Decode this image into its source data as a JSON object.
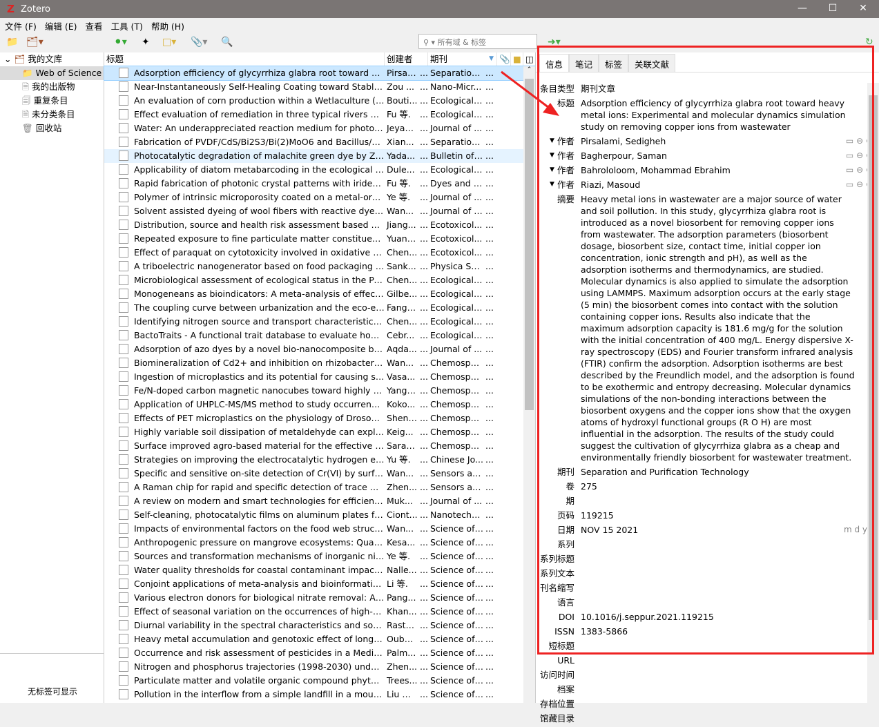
{
  "window": {
    "title": "Zotero",
    "icon": "zotero-logo-icon"
  },
  "menu": [
    "文件 (F)",
    "编辑 (E)",
    "查看",
    "工具 (T)",
    "帮助 (H)"
  ],
  "search": {
    "placeholder": "所有域 & 标签"
  },
  "collections": [
    {
      "label": "我的文库",
      "icon": "library-icon",
      "level": 0
    },
    {
      "label": "Web of Science",
      "icon": "folder-icon",
      "level": 1,
      "selected": true
    },
    {
      "label": "我的出版物",
      "icon": "publications-icon",
      "level": 1
    },
    {
      "label": "重复条目",
      "icon": "duplicate-icon",
      "level": 1
    },
    {
      "label": "未分类条目",
      "icon": "unfiled-icon",
      "level": 1
    },
    {
      "label": "回收站",
      "icon": "trash-icon",
      "level": 1
    }
  ],
  "tag_selector": {
    "empty_text": "无标签可显示"
  },
  "columns": {
    "title": "标题",
    "creator": "创建者",
    "journal": "期刊"
  },
  "items": [
    [
      "Adsorption efficiency of glycyrrhiza glabra root toward heavy metal ions",
      "Pirsal...",
      "Separation ..."
    ],
    [
      "Near-Instantaneously Self-Healing Coating toward Stable and...",
      "Zou ...",
      "Nano-Micr..."
    ],
    [
      "An evaluation of corn production within a Wetlaculture (TM) s...",
      "Bouti...",
      "Ecological ..."
    ],
    [
      "Effect evaluation of remediation in three typical rivers with Va...",
      "Fu 等.",
      "Ecological ..."
    ],
    [
      "Water: An underappreciated reaction medium for photodimer...",
      "Jeyap...",
      "Journal of ..."
    ],
    [
      "Fabrication of PVDF/CdS/Bi2S3/Bi(2)MoO6 and Bacillus/PVA ...",
      "Xian...",
      "Separation ..."
    ],
    [
      "Photocatalytic degradation of malachite green dye by ZnO an...",
      "Yada...",
      "Bulletin of ..."
    ],
    [
      "Applicability of diatom metabarcoding in the ecological statu...",
      "Dule...",
      "Ecological I..."
    ],
    [
      "Rapid fabrication of photonic crystal patterns with iridescent s...",
      "Fu 等.",
      "Dyes and P..."
    ],
    [
      "Polymer of intrinsic microporosity coated on a metal-organic ...",
      "Ye 等.",
      "Journal of ..."
    ],
    [
      "Solvent assisted dyeing of wool fibers with reactive dyes in a t...",
      "Wan...",
      "Journal of I..."
    ],
    [
      "Distribution, source and health risk assessment based on the ...",
      "Jiang...",
      "Ecotoxicol..."
    ],
    [
      "Repeated exposure to fine particulate matter constituents lea...",
      "Yuan ...",
      "Ecotoxicol..."
    ],
    [
      "Effect of paraquat on cytotoxicity involved in oxidative stress ...",
      "Chen...",
      "Ecotoxicol..."
    ],
    [
      "A triboelectric nanogenerator based on food packaging Alum...",
      "Sank...",
      "Physica Scr..."
    ],
    [
      "Microbiological assessment of ecological status in the Pearl Ri...",
      "Chen...",
      "Ecological I..."
    ],
    [
      "Monogeneans as bioindicators: A meta-analysis of effect size ...",
      "Gilbe...",
      "Ecological I..."
    ],
    [
      "The coupling curve between urbanization and the eco-enviro...",
      "Fang ...",
      "Ecological I..."
    ],
    [
      "Identifying nitrogen source and transport characteristics of th...",
      "Chen...",
      "Ecological I..."
    ],
    [
      "BactoTraits - A functional trait database to evaluate how natu...",
      "Cebr...",
      "Ecological I..."
    ],
    [
      "Adsorption of azo dyes by a novel bio-nanocomposite based ...",
      "Aqda...",
      "Journal of ..."
    ],
    [
      "Biomineralization of Cd2+ and inhibition on rhizobacterial Cd...",
      "Wan...",
      "Chemosph..."
    ],
    [
      "Ingestion of microplastics and its potential for causing structu...",
      "Vasa...",
      "Chemosph..."
    ],
    [
      "Fe/N-doped carbon magnetic nanocubes toward highly effici...",
      "Yang ...",
      "Chemosph..."
    ],
    [
      "Application of UHPLC-MS/MS method to study occurrence an...",
      "Koko...",
      "Chemosph..."
    ],
    [
      "Effects of PET microplastics on the physiology of Drosophila",
      "Shen ...",
      "Chemosph..."
    ],
    [
      "Highly variable soil dissipation of metaldehyde can explain its...",
      "Keig...",
      "Chemosph..."
    ],
    [
      "Surface improved agro-based material for the effective separ...",
      "Sarav...",
      "Chemosph..."
    ],
    [
      "Strategies on improving the electrocatalytic hydrogen evoluti...",
      "Yu 等.",
      "Chinese Jo..."
    ],
    [
      "Specific and sensitive on-site detection of Cr(VI) by surface-e...",
      "Wan...",
      "Sensors an..."
    ],
    [
      "A Raman chip for rapid and specific detection of trace mercur...",
      "Zhen...",
      "Sensors an..."
    ],
    [
      "A review on modern and smart technologies for efficient wast...",
      "Muk...",
      "Journal of ..."
    ],
    [
      "Self-cleaning, photocatalytic films on aluminum plates for mu...",
      "Ciont...",
      "Nanotechn..."
    ],
    [
      "Impacts of environmental factors on the food web structure, ...",
      "Wan...",
      "Science of ..."
    ],
    [
      "Anthropogenic pressure on mangrove ecosystems: Quantifica...",
      "Kesa...",
      "Science of ..."
    ],
    [
      "Sources and transformation mechanisms of inorganic nitroge...",
      "Ye 等.",
      "Science of ..."
    ],
    [
      "Water quality thresholds for coastal contaminant impacts on ...",
      "Nalle...",
      "Science of ..."
    ],
    [
      "Conjoint applications of meta-analysis and bioinformatic data...",
      "Li 等.",
      "Science of ..."
    ],
    [
      "Various electron donors for biological nitrate removal: A review",
      "Pang...",
      "Science of ..."
    ],
    [
      "Effect of seasonal variation on the occurrences of high-risk ph...",
      "Khan...",
      "Science of ..."
    ],
    [
      "Diurnal variability in the spectral characteristics and sources o...",
      "Rasto...",
      "Science of ..."
    ],
    [
      "Heavy metal accumulation and genotoxic effect of long-term ...",
      "Ouba...",
      "Science of ..."
    ],
    [
      "Occurrence and risk assessment of pesticides in a Mediterran...",
      "Palm...",
      "Science of ..."
    ],
    [
      "Nitrogen and phosphorus trajectories (1998-2030) under regi...",
      "Zhen...",
      "Science of ..."
    ],
    [
      "Particulate matter and volatile organic compound phytoreme...",
      "Trees...",
      "Science of ..."
    ],
    [
      "Pollution in the interflow from a simple landfill in a mountain...",
      "Liu 等...",
      "Science of ..."
    ]
  ],
  "ellipsis": "...",
  "tabs": [
    "信息",
    "笔记",
    "标签",
    "关联文献"
  ],
  "info": {
    "item_type": {
      "label": "条目类型",
      "value": "期刊文章"
    },
    "title": {
      "label": "标题",
      "value": "Adsorption efficiency of glycyrrhiza glabra root toward heavy metal ions: Experimental and molecular dynamics simulation study on removing copper ions from wastewater"
    },
    "creators": [
      {
        "label": "作者",
        "value": "Pirsalami, Sedigheh"
      },
      {
        "label": "作者",
        "value": "Bagherpour, Saman"
      },
      {
        "label": "作者",
        "value": "Bahrololoom, Mohammad Ebrahim"
      },
      {
        "label": "作者",
        "value": "Riazi, Masoud"
      }
    ],
    "fields": [
      {
        "label": "摘要",
        "value": "Heavy metal ions in wastewater are a major source of water and soil pollution. In this study, glycyrrhiza glabra root is introduced as a novel biosorbent for removing copper ions from wastewater. The adsorption parameters (biosorbent dosage, biosorbent size, contact time, initial copper ion concentration, ionic strength and pH), as well as the adsorption isotherms and thermodynamics, are studied. Molecular dynamics is also applied to simulate the adsorption using LAMMPS. Maximum adsorption occurs at the early stage (5 min) the biosorbent comes into contact with the solution containing copper ions. Results also indicate that the maximum adsorption capacity is 181.6 mg/g for the solution with the initial concentration of 400 mg/L. Energy dispersive X-ray spectroscopy (EDS) and Fourier transform infrared analysis (FTIR) confirm the adsorption. Adsorption isotherms are best described by the Freundlich model, and the adsorption is found to be exothermic and entropy decreasing. Molecular dynamics simulations of the non-bonding interactions between the biosorbent oxygens and the copper ions show that the oxygen atoms of hydroxyl functional groups (R O H) are most influential in the adsorption. The results of the study could suggest the cultivation of glycyrrhiza glabra as a cheap and environmentally friendly biosorbent for wastewater treatment."
      },
      {
        "label": "期刊",
        "value": "Separation and Purification Technology"
      },
      {
        "label": "卷",
        "value": "275"
      },
      {
        "label": "期",
        "value": ""
      },
      {
        "label": "页码",
        "value": "119215"
      },
      {
        "label": "日期",
        "value": "NOV 15 2021",
        "extra": "m d y"
      },
      {
        "label": "系列",
        "value": ""
      },
      {
        "label": "系列标题",
        "value": ""
      },
      {
        "label": "系列文本",
        "value": ""
      },
      {
        "label": "刊名缩写",
        "value": ""
      },
      {
        "label": "语言",
        "value": ""
      },
      {
        "label": "DOI",
        "value": "10.1016/j.seppur.2021.119215"
      },
      {
        "label": "ISSN",
        "value": "1383-5866"
      },
      {
        "label": "短标题",
        "value": ""
      },
      {
        "label": "URL",
        "value": ""
      },
      {
        "label": "访问时间",
        "value": ""
      },
      {
        "label": "档案",
        "value": ""
      },
      {
        "label": "存档位置",
        "value": ""
      },
      {
        "label": "馆藏目录",
        "value": ""
      }
    ]
  },
  "colors": {
    "selection": "#cce8ff",
    "highlight_box": "#ee2222",
    "titlebar": "#7a7574"
  }
}
